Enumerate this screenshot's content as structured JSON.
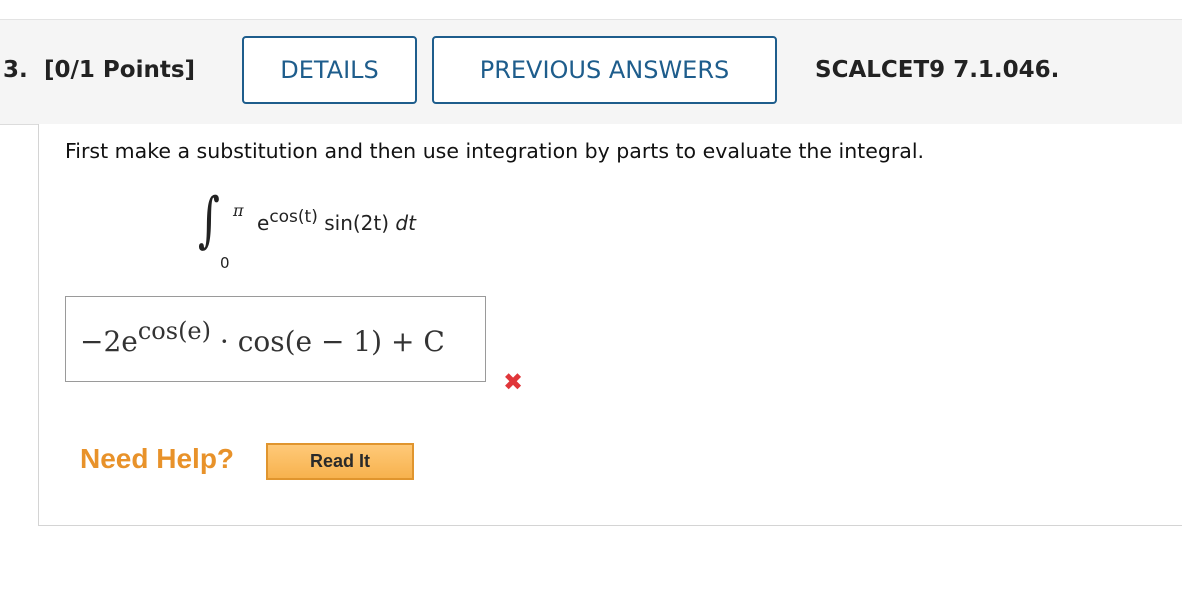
{
  "header": {
    "question_number": "3.",
    "points": "[0/1 Points]",
    "details_button": "DETAILS",
    "previous_answers_button": "PREVIOUS ANSWERS",
    "question_code": "SCALCET9 7.1.046."
  },
  "question": {
    "prompt": "First make a substitution and then use integration by parts to evaluate the integral.",
    "integral": {
      "upper_limit": "π",
      "lower_limit": "0",
      "base": "e",
      "exponent": "cos(t)",
      "factor": "sin(2t)",
      "differential": "dt"
    }
  },
  "answer": {
    "coefficient": "−2e",
    "exponent": "cos(e)",
    "dot": " · ",
    "tail": "cos(e − 1) + C",
    "status": "incorrect"
  },
  "help": {
    "label": "Need Help?",
    "read_it_button": "Read It"
  },
  "colors": {
    "button_border": "#1e5d8c",
    "incorrect": "#e0363a",
    "help_text": "#e8922a",
    "read_it_fill": "#f7b24e"
  },
  "icons": {
    "incorrect_mark": "✖"
  }
}
